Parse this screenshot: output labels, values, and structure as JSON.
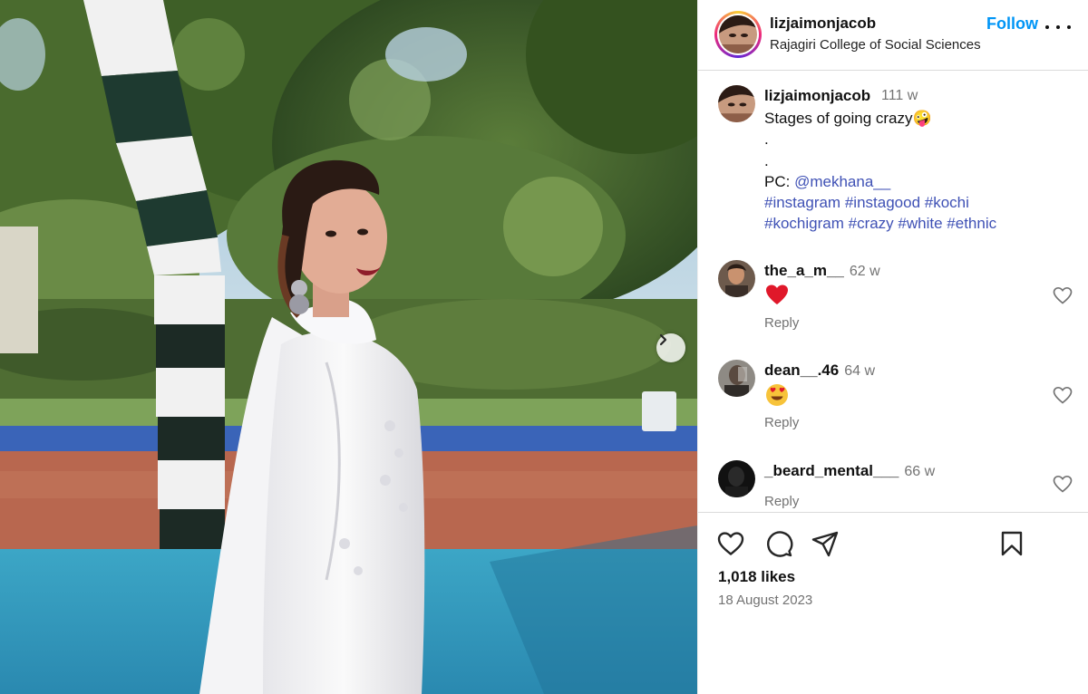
{
  "post": {
    "author": "lizjaimonjacob",
    "location": "Rajagiri College of Social Sciences",
    "follow_label": "Follow",
    "caption": {
      "user": "lizjaimonjacob",
      "time": "111 w",
      "text": "Stages of going crazy",
      "text_emoji": "🤪",
      "dot1": ".",
      "dot2": ".",
      "pc_prefix": "PC:",
      "pc_handle": "@mekhana__",
      "hashtags_line1": [
        "#instagram",
        "#instagood",
        "#kochi"
      ],
      "hashtags_line2": [
        "#kochigram",
        "#crazy",
        "#white",
        "#ethnic"
      ]
    },
    "comments": [
      {
        "user": "the_a_m__",
        "time": "62 w",
        "emoji": "heart",
        "reply": "Reply"
      },
      {
        "user": "dean__.46",
        "time": "64 w",
        "emoji": "heart-eyes",
        "reply": "Reply"
      },
      {
        "user": "_beard_mental___",
        "time": "66 w",
        "emoji": "",
        "reply": "Reply"
      }
    ],
    "likes": "1,018 likes",
    "date": "18 August 2023"
  },
  "icons": {
    "like": "heart-outline-icon",
    "comment": "comment-bubble-icon",
    "share": "paper-plane-icon",
    "save": "bookmark-icon",
    "next": "chevron-right-icon",
    "more": "more-horizontal-icon"
  },
  "colors": {
    "accent": "#0095f6",
    "link": "#3f51b5",
    "muted": "#737373",
    "heart_red": "#e0182a"
  }
}
